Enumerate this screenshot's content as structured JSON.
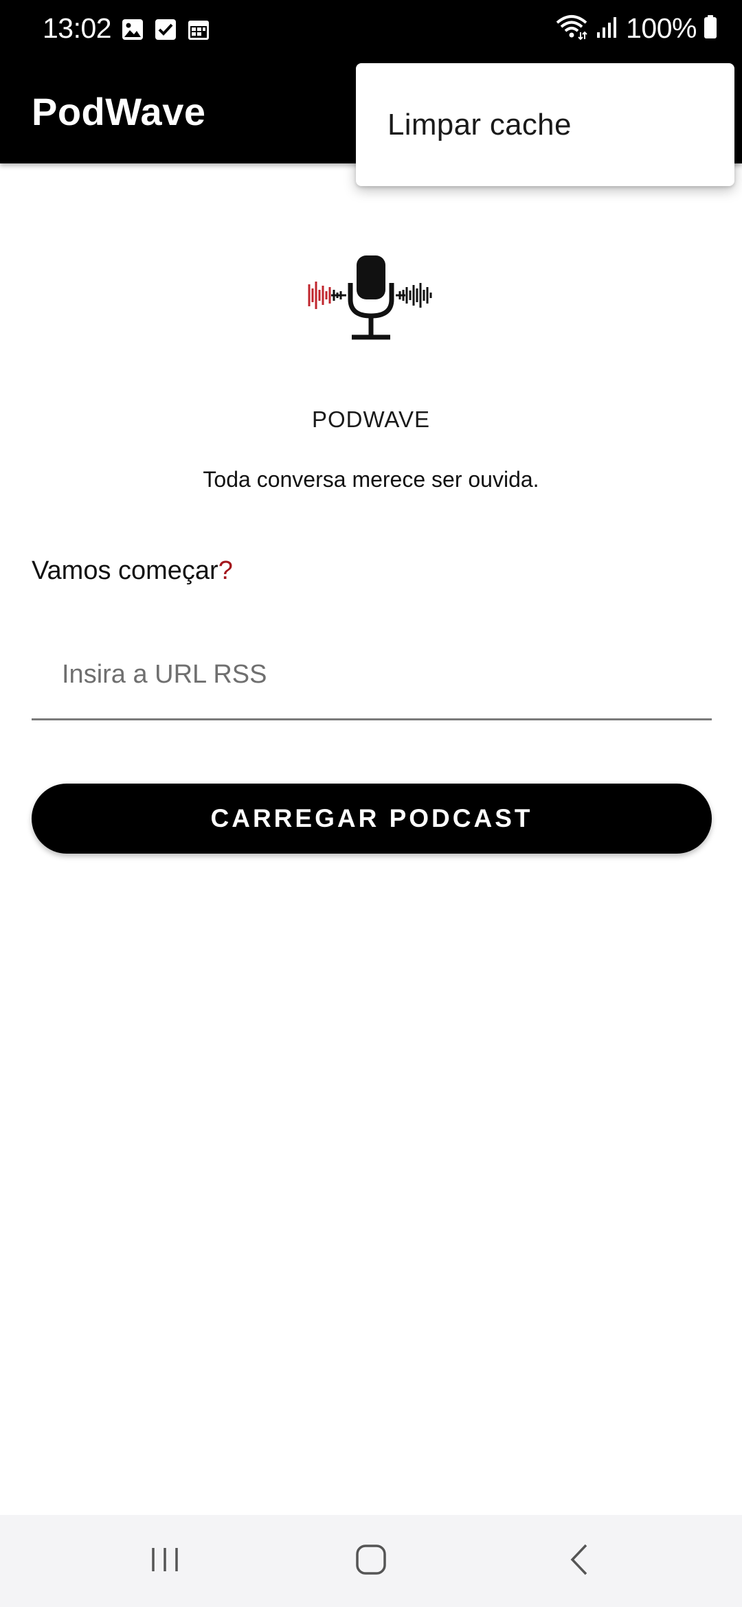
{
  "status_bar": {
    "time": "13:02",
    "battery_text": "100%",
    "left_icons": [
      "image-icon",
      "check-box-icon",
      "calendar-icon"
    ],
    "right_icons": [
      "wifi-icon",
      "signal-icon",
      "battery-icon"
    ]
  },
  "app_bar": {
    "title": "PodWave"
  },
  "overflow_menu": {
    "items": [
      {
        "label": "Limpar cache"
      }
    ]
  },
  "main": {
    "logo_icon": "microphone-soundwave-logo",
    "brand_name": "PODWAVE",
    "tagline": "Toda conversa merece ser ouvida.",
    "prompt_text": "Vamos começar",
    "prompt_mark": "?",
    "url_input": {
      "placeholder": "Insira a URL RSS",
      "value": ""
    },
    "load_button_label": "CARREGAR PODCAST"
  },
  "nav_bar": {
    "buttons": [
      "recents-icon",
      "home-icon",
      "back-icon"
    ]
  },
  "colors": {
    "app_bar_bg": "#000000",
    "accent_red": "#a3151c",
    "button_bg": "#000000",
    "nav_bar_bg": "#f4f4f6"
  }
}
